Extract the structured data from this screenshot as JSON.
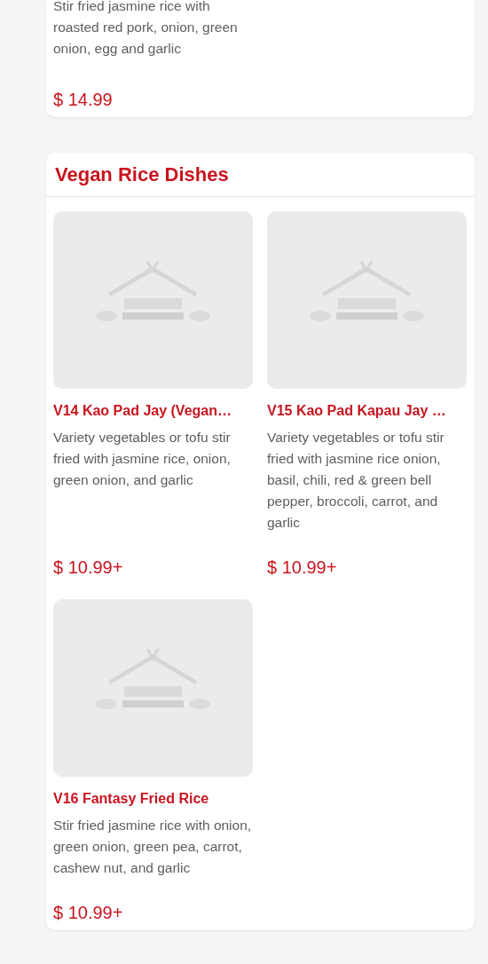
{
  "sections": [
    {
      "items": [
        {
          "description": "Stir fried jasmine rice with roasted red pork, onion, green onion, egg and garlic",
          "price": "$ 14.99",
          "image": false
        }
      ]
    },
    {
      "title": "Vegan Rice Dishes",
      "items": [
        {
          "name": "V14 Kao Pad Jay (Vegan…",
          "description": "Variety vegetables or tofu stir fried with jasmine rice, onion, green onion, and garlic",
          "price": "$ 10.99+",
          "image": true
        },
        {
          "name": "V15 Kao Pad Kapau Jay …",
          "description": "Variety vegetables or tofu stir fried with jasmine rice onion, basil, chili, red & green bell pepper, broccoli, carrot, and garlic",
          "price": "$ 10.99+",
          "image": true
        },
        {
          "name": "V16 Fantasy Fried Rice",
          "description": "Stir fried jasmine rice with onion, green onion, green pea, carrot, cashew nut, and garlic",
          "price": "$ 10.99+",
          "image": true
        }
      ]
    }
  ]
}
